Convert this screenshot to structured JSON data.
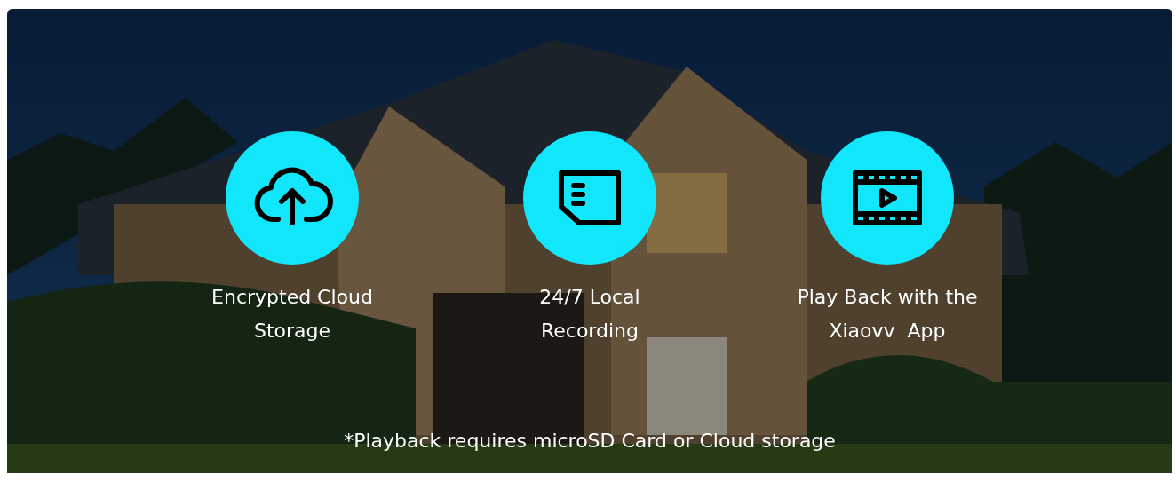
{
  "banner": {
    "features": [
      {
        "kind": "cloud",
        "label": "Encrypted Cloud Storage"
      },
      {
        "kind": "card",
        "label": "24/7 Local Recording"
      },
      {
        "kind": "video",
        "label": "Play Back with the Xiaovv  App"
      }
    ],
    "footnote": "*Playback requires microSD Card or Cloud storage"
  }
}
